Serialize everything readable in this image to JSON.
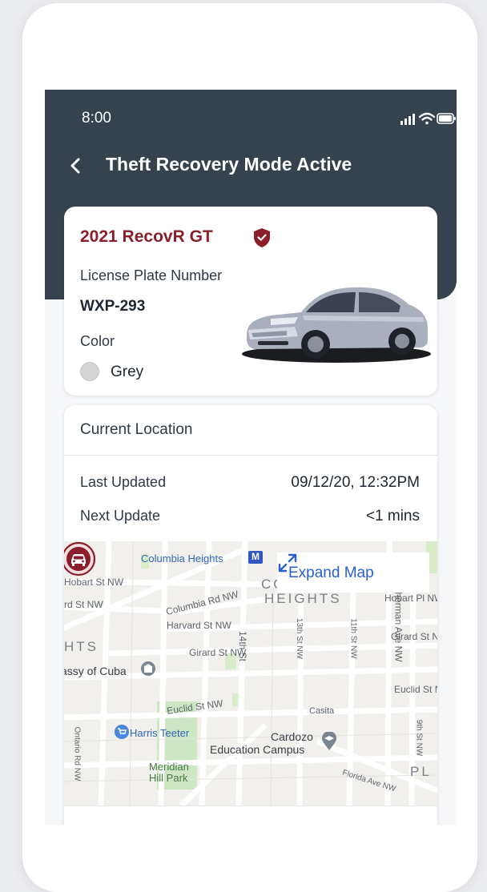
{
  "status_bar": {
    "time": "8:00"
  },
  "header": {
    "title": "Theft Recovery Mode Active"
  },
  "vehicle": {
    "name": "2021 RecovR GT",
    "plate_label": "License Plate Number",
    "plate_value": "WXP-293",
    "color_label": "Color",
    "color_value": "Grey",
    "color_hex": "#d4d5d2"
  },
  "location": {
    "title": "Current Location",
    "last_updated_label": "Last Updated",
    "last_updated_value": "09/12/20, 12:32PM",
    "next_update_label": "Next Update",
    "next_update_value": "<1 mins",
    "expand_label": "Expand Map"
  },
  "map": {
    "labels": {
      "columbia_heights_station": "Columbia Heights",
      "metro_badge": "M",
      "hobart_st_w": "Hobart St NW",
      "hobart_pl": "Hobart Pl NW",
      "columbia_rd": "Columbia Rd NW",
      "rd_st": "rd St NW",
      "neighborhood_top": "COL",
      "neighborhood_heights": "HEIGHTS",
      "harvard": "Harvard St NW",
      "hts": "HTS",
      "girard_w": "Girard St NW",
      "girard_e": "Girard St NW",
      "fourteenth": "14th St",
      "thirteenth": "13th St NW",
      "eleventh": "11th St NW",
      "sherman": "Sherman Ave NW",
      "embassy": "assy of Cuba",
      "euclid_w": "Euclid St NW",
      "euclid_e": "Euclid St NW",
      "casita": "Casita",
      "harris_teeter": "Harris Teeter",
      "cardozo_1": "Cardozo",
      "cardozo_2": "Education Campus",
      "ontario": "Ontario Rd NW",
      "meridian_1": "Meridian",
      "meridian_2": "Hill Park",
      "florida": "Florida Ave NW",
      "ninth": "9th St NW",
      "pl": "PL"
    }
  },
  "colors": {
    "header_bg": "#37424f",
    "brand_red": "#8a1f2b",
    "link_blue": "#2a5fd0"
  },
  "icons": {
    "back": "chevron-left-icon",
    "shield": "shield-check-icon",
    "signal": "cellular-signal-icon",
    "wifi": "wifi-icon",
    "battery": "battery-icon",
    "expand": "expand-arrows-icon",
    "marker": "car-location-marker-icon"
  }
}
